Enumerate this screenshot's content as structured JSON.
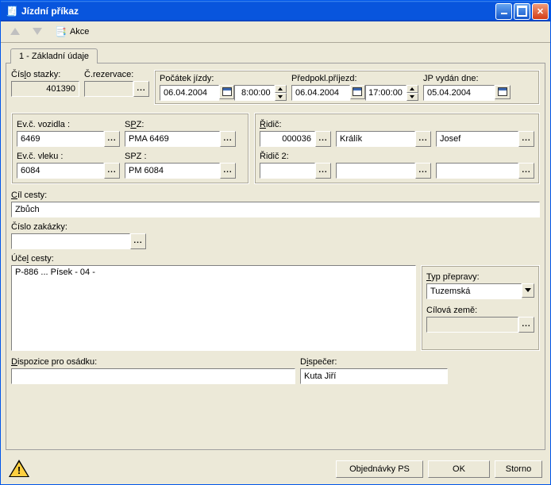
{
  "window": {
    "title": "Jízdní příkaz"
  },
  "toolbar": {
    "akce": "Akce"
  },
  "tab": {
    "label": "1 - Základní údaje"
  },
  "top": {
    "cislo_stazky_label_pre": "Čís",
    "cislo_stazky_label_u": "l",
    "cislo_stazky_label_post": "o stazky:",
    "cislo_stazky": "401390",
    "cislo_rezervace_label": "Č.rezervace:",
    "cislo_rezervace": "",
    "pocatek_label": "Počátek jízdy:",
    "pocatek_date": "06.04.2004",
    "pocatek_time": "8:00:00",
    "predpokl_label": "Předpokl.příjezd:",
    "predpokl_date": "06.04.2004",
    "predpokl_time": "17:00:00",
    "jp_label": "JP vydán dne:",
    "jp_date": "05.04.2004"
  },
  "veh": {
    "evc_vozidla_label": "Ev.č. vozidla :",
    "evc_vozidla": "6469",
    "spz1_label_pre": "S",
    "spz1_label_u": "P",
    "spz1_label_post": "Z:",
    "spz1": "PMA 6469",
    "evc_vleku_label": "Ev.č. vleku :",
    "evc_vleku": "6084",
    "spz2_label": "SPZ :",
    "spz2": "PM 6084"
  },
  "drv": {
    "ridic_label_u": "Ř",
    "ridic_label_post": "idič:",
    "ridic_id": "000036",
    "ridic_surname": "Králík",
    "ridic_first": "Josef",
    "ridic2_label": "Řidič 2:",
    "ridic2_id": "",
    "ridic2_surname": "",
    "ridic2_first": ""
  },
  "trip": {
    "cil_label_u": "C",
    "cil_label_post": "íl cesty:",
    "cil": "Zbůch",
    "zakazka_label": "Číslo zakázky:",
    "zakazka": "",
    "ucel_label_pre": "Úče",
    "ucel_label_u": "l",
    "ucel_label_post": " cesty:",
    "ucel": "P-886 ... Písek - 04 -",
    "typ_label_u": "T",
    "typ_label_post": "yp přepravy:",
    "typ": "Tuzemská",
    "zeme_label": "Cílová země:",
    "zeme": "",
    "dispozice_label_u": "D",
    "dispozice_label_post": "ispozice pro osádku:",
    "dispozice": "",
    "dispecer_label_pre": "D",
    "dispecer_label_u": "i",
    "dispecer_label_post": "spečer:",
    "dispecer": "Kuta Jiří"
  },
  "footer": {
    "objednavky": "Objednávky PS",
    "ok": "OK",
    "storno": "Storno"
  }
}
